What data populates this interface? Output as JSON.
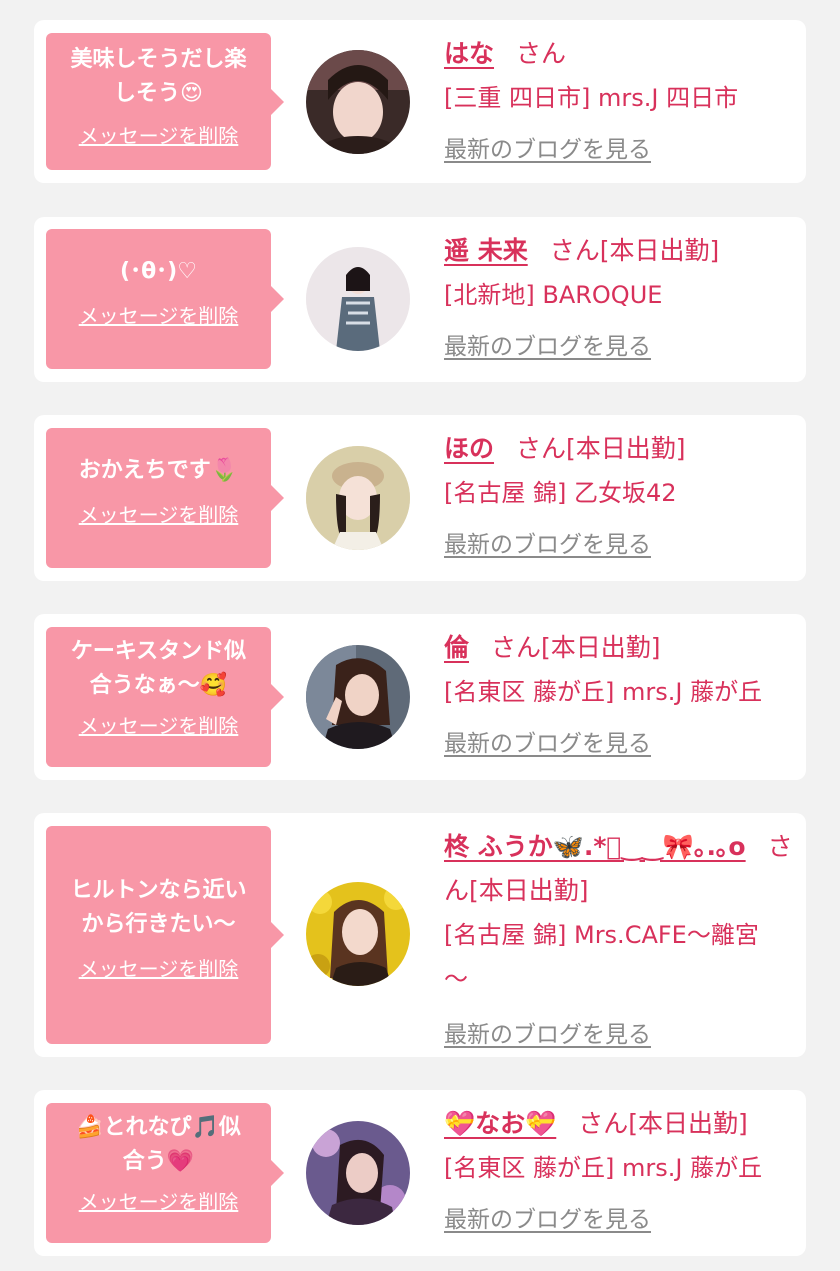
{
  "delete_label": "メッセージを削除",
  "blog_label": "最新のブログを見る",
  "honorific": "さん",
  "colors": {
    "background": "#f2f2f2",
    "bubble": "#f897a7",
    "name_text": "#d8315b",
    "link_gray": "#8a8a8a"
  },
  "cards": [
    {
      "message_lines": [
        "美味しそうだし楽",
        "しそう😍"
      ],
      "name": "はな",
      "status": "",
      "shop_lines": [
        "[三重 四日市] mrs.J 四日市"
      ]
    },
    {
      "message_lines": [
        "(･θ･)♡"
      ],
      "name": "遥 未来",
      "status": "[本日出勤]",
      "shop_lines": [
        "[北新地] BAROQUE"
      ]
    },
    {
      "message_lines": [
        "おかえちです🌷"
      ],
      "name": "ほの",
      "status": "[本日出勤]",
      "shop_lines": [
        "[名古屋 錦] 乙女坂42"
      ]
    },
    {
      "message_lines": [
        "ケーキスタンド似",
        "合うなぁ〜🥰"
      ],
      "name": "倫",
      "status": "[本日出勤]",
      "shop_lines": [
        "[名東区 藤が丘] mrs.J 藤が丘"
      ]
    },
    {
      "message_lines": [
        "ヒルトンなら近い",
        "から行きたい〜"
      ],
      "name": "柊 ふうか🦋.*ﾟ‿‿🎀｡.｡o",
      "name_tail": "さ",
      "status_line": "ん[本日出勤]",
      "shop_lines": [
        "[名古屋 錦] Mrs.CAFE〜離宮",
        "〜"
      ]
    },
    {
      "message_lines": [
        "🍰とれなぴ🎵似",
        "合う💗"
      ],
      "name": "💝なお💝",
      "status": "[本日出勤]",
      "shop_lines": [
        "[名東区 藤が丘] mrs.J 藤が丘"
      ]
    }
  ]
}
